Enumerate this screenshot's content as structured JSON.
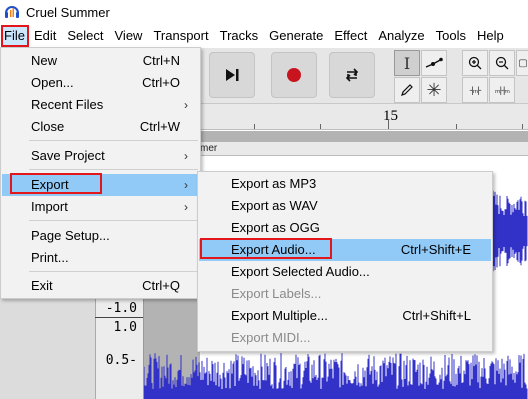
{
  "window": {
    "title": "Cruel Summer"
  },
  "menubar": {
    "items": [
      "File",
      "Edit",
      "Select",
      "View",
      "Transport",
      "Tracks",
      "Generate",
      "Effect",
      "Analyze",
      "Tools",
      "Help"
    ],
    "active": "File"
  },
  "ruler": {
    "label": "15"
  },
  "track": {
    "name_fragment": "mer",
    "scale_labels": [
      "-1.0",
      "1.0",
      "0.5-"
    ],
    "waveform_color": "#3232c8"
  },
  "file_menu": {
    "items": [
      {
        "label": "New",
        "shortcut": "Ctrl+N"
      },
      {
        "label": "Open...",
        "shortcut": "Ctrl+O"
      },
      {
        "label": "Recent Files",
        "submenu": true
      },
      {
        "label": "Close",
        "shortcut": "Ctrl+W"
      },
      {
        "label": "Save Project",
        "submenu": true
      },
      {
        "label": "Export",
        "submenu": true,
        "highlighted": true
      },
      {
        "label": "Import",
        "submenu": true
      },
      {
        "label": "Page Setup..."
      },
      {
        "label": "Print..."
      },
      {
        "label": "Exit",
        "shortcut": "Ctrl+Q"
      }
    ],
    "submenu_arrow": "›"
  },
  "export_menu": {
    "items": [
      {
        "label": "Export as MP3"
      },
      {
        "label": "Export as WAV"
      },
      {
        "label": "Export as OGG"
      },
      {
        "label": "Export Audio...",
        "shortcut": "Ctrl+Shift+E",
        "highlighted": true
      },
      {
        "label": "Export Selected Audio..."
      },
      {
        "label": "Export Labels...",
        "disabled": true
      },
      {
        "label": "Export Multiple...",
        "shortcut": "Ctrl+Shift+L"
      },
      {
        "label": "Export MIDI...",
        "disabled": true
      }
    ]
  },
  "colors": {
    "highlight": "#91c9f7",
    "annotation_red": "#e3161b",
    "menu_bg": "#f2f2f2"
  }
}
